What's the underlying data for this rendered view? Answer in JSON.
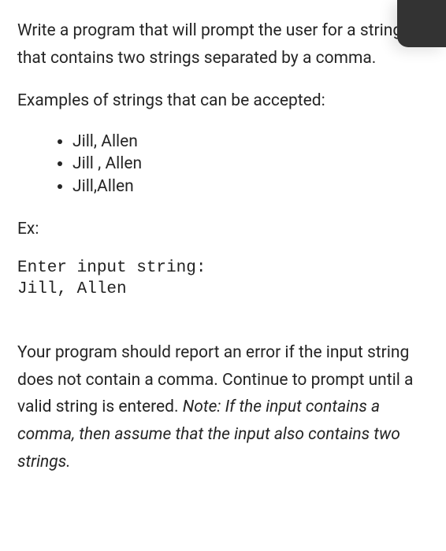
{
  "intro": "Write a program that will prompt the user for a string that contains two strings separated by a comma.",
  "examples_label": "Examples of strings that can be accepted:",
  "bullets": {
    "b1": "Jill, Allen",
    "b2": "Jill , Allen",
    "b3": "Jill,Allen"
  },
  "ex_label": "Ex:",
  "code": "Enter input string:\nJill, Allen",
  "error_text_plain": "Your program should report an error if the input string does not contain a comma. Continue to prompt until a valid string is entered. ",
  "error_text_italic": "Note: If the input contains a comma, then assume that the input also contains two strings."
}
